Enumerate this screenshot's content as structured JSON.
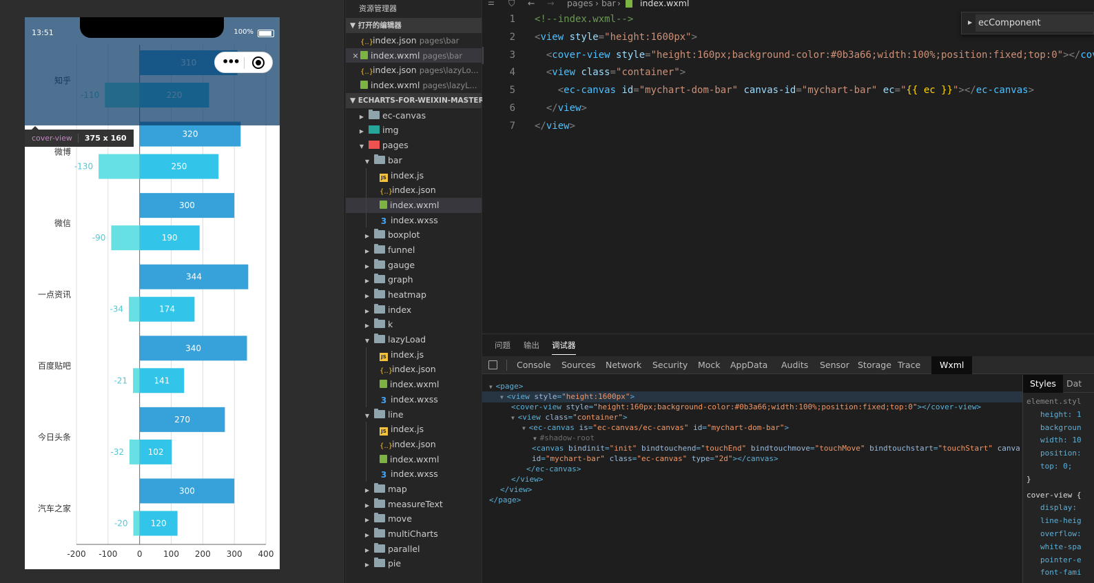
{
  "simulator": {
    "time": "13:51",
    "battery": "100%",
    "tooltip": {
      "tag": "cover-view",
      "size": "375 x 160"
    }
  },
  "chart_data": {
    "type": "bar",
    "orientation": "horizontal",
    "categories": [
      "汽车之家",
      "今日头条",
      "百度贴吧",
      "一点资讯",
      "微信",
      "微博",
      "知乎"
    ],
    "series": [
      {
        "values": [
          300,
          270,
          340,
          344,
          300,
          320,
          310
        ],
        "color": "#37a2da"
      },
      {
        "values": [
          120,
          102,
          141,
          174,
          190,
          250,
          220
        ],
        "color": "#32c5e9"
      },
      {
        "values": [
          -20,
          -32,
          -21,
          -34,
          -90,
          -130,
          -110
        ],
        "color": "#67e0e3"
      }
    ],
    "x_ticks": [
      "-200",
      "-100",
      "0",
      "100",
      "200",
      "300",
      "400"
    ],
    "xlim": [
      -200,
      400
    ],
    "grid": true
  },
  "explorer": {
    "title": "资源管理器",
    "open_editors_label": "打开的编辑器",
    "open_editors": [
      {
        "name": "index.json",
        "hint": "pages\\bar",
        "icon": "json-icon"
      },
      {
        "name": "index.wxml",
        "hint": "pages\\bar",
        "icon": "wxml-icon",
        "close": "✕"
      },
      {
        "name": "index.json",
        "hint": "pages\\lazyLo...",
        "icon": "json-icon"
      },
      {
        "name": "index.wxml",
        "hint": "pages\\lazyL...",
        "icon": "wxml-icon"
      }
    ],
    "project_label": "ECHARTS-FOR-WEIXIN-MASTER",
    "tree": [
      {
        "name": "ec-canvas",
        "type": "folder",
        "depth": 0,
        "open": false
      },
      {
        "name": "img",
        "type": "img",
        "depth": 0,
        "open": false
      },
      {
        "name": "pages",
        "type": "pages",
        "depth": 0,
        "open": true
      },
      {
        "name": "bar",
        "type": "folder",
        "depth": 1,
        "open": true
      },
      {
        "name": "index.js",
        "type": "js",
        "depth": 2
      },
      {
        "name": "index.json",
        "type": "json",
        "depth": 2
      },
      {
        "name": "index.wxml",
        "type": "wxml",
        "depth": 2,
        "selected": true
      },
      {
        "name": "index.wxss",
        "type": "wxss",
        "depth": 2
      },
      {
        "name": "boxplot",
        "type": "folder",
        "depth": 1,
        "open": false
      },
      {
        "name": "funnel",
        "type": "folder",
        "depth": 1,
        "open": false
      },
      {
        "name": "gauge",
        "type": "folder",
        "depth": 1,
        "open": false
      },
      {
        "name": "graph",
        "type": "folder",
        "depth": 1,
        "open": false
      },
      {
        "name": "heatmap",
        "type": "folder",
        "depth": 1,
        "open": false
      },
      {
        "name": "index",
        "type": "folder",
        "depth": 1,
        "open": false
      },
      {
        "name": "k",
        "type": "folder",
        "depth": 1,
        "open": false
      },
      {
        "name": "lazyLoad",
        "type": "folder",
        "depth": 1,
        "open": true
      },
      {
        "name": "index.js",
        "type": "js",
        "depth": 2
      },
      {
        "name": "index.json",
        "type": "json",
        "depth": 2
      },
      {
        "name": "index.wxml",
        "type": "wxml",
        "depth": 2
      },
      {
        "name": "index.wxss",
        "type": "wxss",
        "depth": 2
      },
      {
        "name": "line",
        "type": "folder",
        "depth": 1,
        "open": true
      },
      {
        "name": "index.js",
        "type": "js",
        "depth": 2
      },
      {
        "name": "index.json",
        "type": "json",
        "depth": 2
      },
      {
        "name": "index.wxml",
        "type": "wxml",
        "depth": 2
      },
      {
        "name": "index.wxss",
        "type": "wxss",
        "depth": 2
      },
      {
        "name": "map",
        "type": "folder",
        "depth": 1,
        "open": false
      },
      {
        "name": "measureText",
        "type": "folder",
        "depth": 1,
        "open": false
      },
      {
        "name": "move",
        "type": "folder",
        "depth": 1,
        "open": false
      },
      {
        "name": "multiCharts",
        "type": "folder",
        "depth": 1,
        "open": false
      },
      {
        "name": "parallel",
        "type": "folder",
        "depth": 1,
        "open": false
      },
      {
        "name": "pie",
        "type": "folder",
        "depth": 1,
        "open": false
      }
    ]
  },
  "editor": {
    "breadcrumb": [
      "pages",
      "bar",
      "index.wxml"
    ],
    "outline_label": "ecComponent",
    "lines": [
      {
        "n": "1",
        "parts": [
          [
            "c-cm",
            "<!--index.wxml-->"
          ]
        ]
      },
      {
        "n": "2",
        "parts": [
          [
            "c-pn",
            "<"
          ],
          [
            "c-tg",
            "view"
          ],
          [
            "c-at",
            " style"
          ],
          [
            "c-pn",
            "="
          ],
          [
            "c-st",
            "\"height:1600px\""
          ],
          [
            "c-pn",
            ">"
          ]
        ]
      },
      {
        "n": "3",
        "hl": true,
        "parts": [
          [
            "c-pn",
            "  <"
          ],
          [
            "c-tg",
            "cover-view"
          ],
          [
            "c-at",
            " style"
          ],
          [
            "c-pn",
            "="
          ],
          [
            "c-st",
            "\"height:160px;background-color:#0b3a66;width:100%;position:fixed;top:0\""
          ],
          [
            "c-pn",
            "></"
          ],
          [
            "c-tg",
            "cover-view"
          ],
          [
            "c-pn",
            ">"
          ]
        ]
      },
      {
        "n": "4",
        "parts": [
          [
            "c-pn",
            "  <"
          ],
          [
            "c-tg",
            "view"
          ],
          [
            "c-at",
            " class"
          ],
          [
            "c-pn",
            "="
          ],
          [
            "c-st",
            "\"container\""
          ],
          [
            "c-pn",
            ">"
          ]
        ]
      },
      {
        "n": "5",
        "parts": [
          [
            "c-pn",
            "    <"
          ],
          [
            "c-tg",
            "ec-canvas"
          ],
          [
            "c-at",
            " id"
          ],
          [
            "c-pn",
            "="
          ],
          [
            "c-st",
            "\"mychart-dom-bar\""
          ],
          [
            "c-at",
            " canvas-id"
          ],
          [
            "c-pn",
            "="
          ],
          [
            "c-st",
            "\"mychart-bar\""
          ],
          [
            "c-at",
            " ec"
          ],
          [
            "c-pn",
            "="
          ],
          [
            "c-st",
            "\""
          ],
          [
            "c-ex",
            "{{ ec }}"
          ],
          [
            "c-st",
            "\""
          ],
          [
            "c-pn",
            "></"
          ],
          [
            "c-tg",
            "ec-canvas"
          ],
          [
            "c-pn",
            ">"
          ]
        ]
      },
      {
        "n": "6",
        "parts": [
          [
            "c-pn",
            "  </"
          ],
          [
            "c-tg",
            "view"
          ],
          [
            "c-pn",
            ">"
          ]
        ]
      },
      {
        "n": "7",
        "parts": [
          [
            "c-pn",
            "</"
          ],
          [
            "c-tg",
            "view"
          ],
          [
            "c-pn",
            ">"
          ]
        ]
      }
    ]
  },
  "debug": {
    "panel_tabs": [
      "问题",
      "输出",
      "调试器"
    ],
    "devtools_tabs": [
      "Console",
      "Sources",
      "Network",
      "Security",
      "Mock",
      "AppData",
      "Audits",
      "Sensor",
      "Storage",
      "Trace",
      "Wxml"
    ],
    "dom_lines": [
      {
        "ind": 0,
        "tri": "▼",
        "parts": [
          [
            "d-tg",
            "<page>"
          ]
        ]
      },
      {
        "ind": 1,
        "tri": "▼",
        "parts": [
          [
            "d-tg",
            "<view "
          ],
          [
            "d-at",
            "style"
          ],
          [
            "d-tg",
            "="
          ],
          [
            "d-st",
            "\"height:1600px\""
          ],
          [
            "d-tg",
            ">"
          ]
        ]
      },
      {
        "ind": 2,
        "tri": "",
        "sel": true,
        "parts": [
          [
            "d-tg",
            "<cover-view "
          ],
          [
            "d-at",
            "style"
          ],
          [
            "d-tg",
            "="
          ],
          [
            "d-st",
            "\"height:160px;background-color:#0b3a66;width:100%;position:fixed;top:0\""
          ],
          [
            "d-tg",
            "></cover-view>"
          ]
        ]
      },
      {
        "ind": 2,
        "tri": "▼",
        "parts": [
          [
            "d-tg",
            "<view "
          ],
          [
            "d-at",
            "class"
          ],
          [
            "d-tg",
            "="
          ],
          [
            "d-st",
            "\"container\""
          ],
          [
            "d-tg",
            ">"
          ]
        ]
      },
      {
        "ind": 3,
        "tri": "▼",
        "parts": [
          [
            "d-tg",
            "<ec-canvas "
          ],
          [
            "d-at",
            "is"
          ],
          [
            "d-tg",
            "="
          ],
          [
            "d-st",
            "\"ec-canvas/ec-canvas\""
          ],
          [
            "d-at",
            " id"
          ],
          [
            "d-tg",
            "="
          ],
          [
            "d-st",
            "\"mychart-dom-bar\""
          ],
          [
            "d-tg",
            ">"
          ]
        ]
      },
      {
        "ind": 4,
        "tri": "▼",
        "parts": [
          [
            "d-dim",
            "#shadow-root"
          ]
        ]
      },
      {
        "ind": 4,
        "tri": "",
        "parts": [
          [
            "d-tg",
            "<canvas "
          ],
          [
            "d-at",
            "bindinit"
          ],
          [
            "d-tg",
            "="
          ],
          [
            "d-st",
            "\"init\""
          ],
          [
            "d-at",
            " bindtouchend"
          ],
          [
            "d-tg",
            "="
          ],
          [
            "d-st",
            "\"touchEnd\""
          ],
          [
            "d-at",
            " bindtouchmove"
          ],
          [
            "d-tg",
            "="
          ],
          [
            "d-st",
            "\"touchMove\""
          ],
          [
            "d-at",
            " bindtouchstart"
          ],
          [
            "d-tg",
            "="
          ],
          [
            "d-st",
            "\"touchStart\""
          ],
          [
            "d-at",
            " canva"
          ]
        ]
      },
      {
        "ind": 4,
        "tri": "",
        "parts": [
          [
            "d-at",
            "id"
          ],
          [
            "d-tg",
            "="
          ],
          [
            "d-st",
            "\"mychart-bar\""
          ],
          [
            "d-at",
            " class"
          ],
          [
            "d-tg",
            "="
          ],
          [
            "d-st",
            "\"ec-canvas\""
          ],
          [
            "d-at",
            " type"
          ],
          [
            "d-tg",
            "="
          ],
          [
            "d-st",
            "\"2d\""
          ],
          [
            "d-tg",
            "></canvas>"
          ]
        ]
      },
      {
        "ind": 3,
        "tri": "",
        "parts": [
          [
            "d-tg",
            "</ec-canvas>"
          ]
        ]
      },
      {
        "ind": 2,
        "tri": "",
        "parts": [
          [
            "d-tg",
            "</view>"
          ]
        ]
      },
      {
        "ind": 1,
        "tri": "",
        "parts": [
          [
            "d-tg",
            "</view>"
          ]
        ]
      },
      {
        "ind": 0,
        "tri": "",
        "parts": [
          [
            "d-tg",
            "</page>"
          ]
        ]
      }
    ],
    "styles_tab": "Styles",
    "data_tab": "Dat",
    "style_lines": [
      {
        "cls": "s-dim",
        "ind": 0,
        "text": "element.styl"
      },
      {
        "cls": "s-prop",
        "ind": 1,
        "text": "height: 1"
      },
      {
        "cls": "s-prop",
        "ind": 1,
        "text": "backgroun"
      },
      {
        "cls": "s-prop",
        "ind": 1,
        "text": "width: 10"
      },
      {
        "cls": "s-prop",
        "ind": 1,
        "text": "position:"
      },
      {
        "cls": "s-prop",
        "ind": 1,
        "text": "top: 0;"
      },
      {
        "cls": "s-val",
        "ind": 0,
        "text": "}"
      },
      {
        "cls": "s-val",
        "ind": 0,
        "text": "cover-view {"
      },
      {
        "cls": "s-prop",
        "ind": 1,
        "text": "display:"
      },
      {
        "cls": "s-prop",
        "ind": 1,
        "text": "line-heig"
      },
      {
        "cls": "s-prop",
        "ind": 1,
        "text": "overflow:"
      },
      {
        "cls": "s-prop",
        "ind": 1,
        "text": "white-spa"
      },
      {
        "cls": "s-prop",
        "ind": 1,
        "text": "pointer-e"
      },
      {
        "cls": "s-prop",
        "ind": 1,
        "text": "font-fami"
      }
    ]
  }
}
